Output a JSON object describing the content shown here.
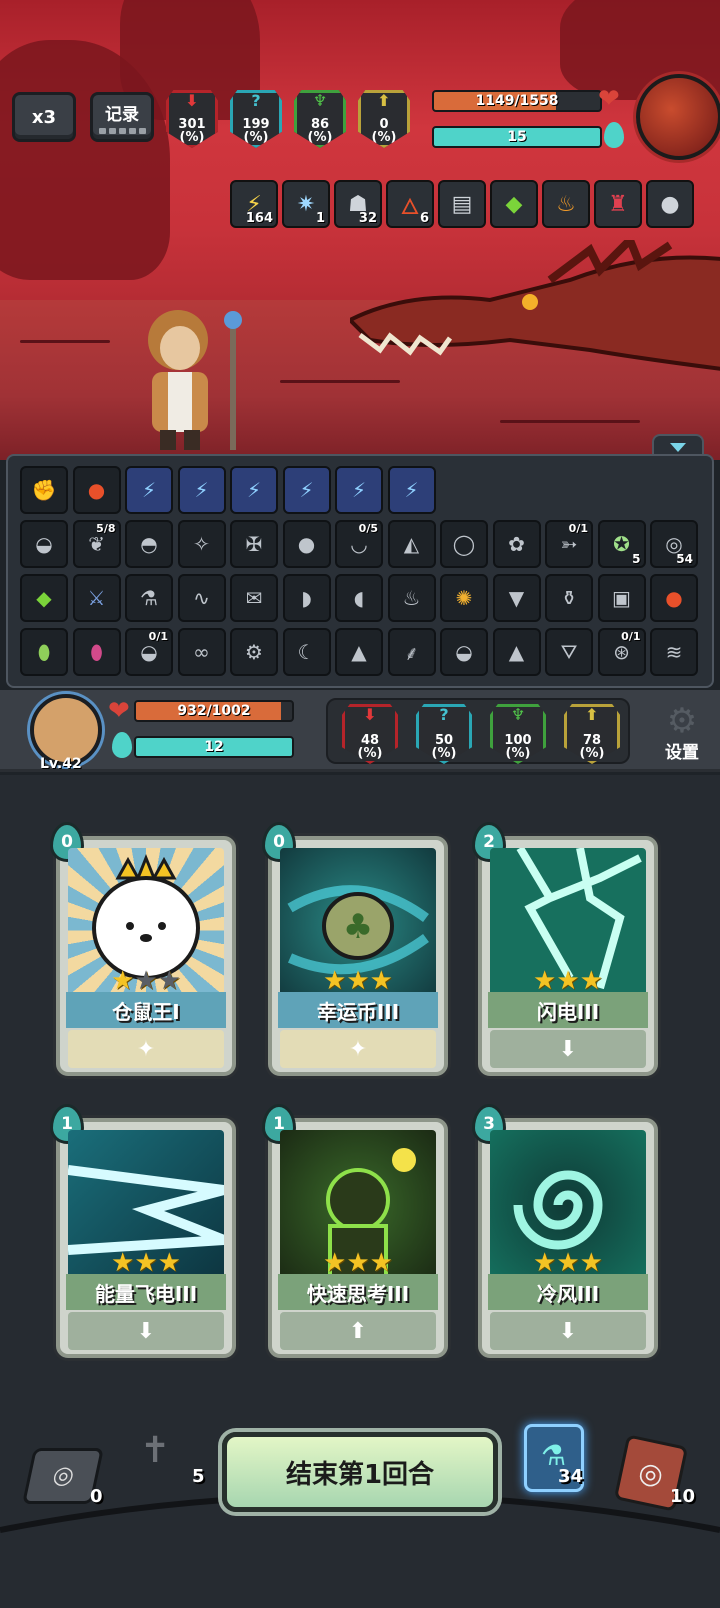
{
  "top_buttons": {
    "speed": "x3",
    "record": "记录"
  },
  "enemy": {
    "stats": [
      {
        "value": "301",
        "unit": "(%)"
      },
      {
        "value": "199",
        "unit": "(%)"
      },
      {
        "value": "86",
        "unit": "(%)"
      },
      {
        "value": "0",
        "unit": "(%)"
      }
    ],
    "hp_text": "1149/1558",
    "hp_fraction": 0.737,
    "mana_text": "15",
    "mana_fraction": 1.0,
    "buffs": [
      {
        "icon": "lightning-icon",
        "count": "164"
      },
      {
        "icon": "spark-icon",
        "count": "1"
      },
      {
        "icon": "hooded-figure-icon",
        "count": "32"
      },
      {
        "icon": "flame-icon",
        "count": "6"
      },
      {
        "icon": "book-icon",
        "count": ""
      },
      {
        "icon": "green-gem-icon",
        "count": ""
      },
      {
        "icon": "fire-cup-icon",
        "count": ""
      },
      {
        "icon": "red-potion-icon",
        "count": ""
      },
      {
        "icon": "bomb-icon",
        "count": ""
      }
    ]
  },
  "inventory": {
    "row1": [
      {
        "icon": "fist-icon",
        "count": ""
      },
      {
        "icon": "fire-apple-icon",
        "count": ""
      },
      {
        "icon": "lightning-card-icon",
        "count": ""
      },
      {
        "icon": "lightning-card-icon",
        "count": ""
      },
      {
        "icon": "lightning-card-icon",
        "count": ""
      },
      {
        "icon": "lightning-card-icon",
        "count": ""
      },
      {
        "icon": "lightning-card-icon",
        "count": ""
      },
      {
        "icon": "lightning-card-icon",
        "count": ""
      }
    ],
    "row2": [
      {
        "icon": "sack-icon",
        "count": "",
        "top": ""
      },
      {
        "icon": "leaf-blade-icon",
        "count": "",
        "top": "5/8"
      },
      {
        "icon": "bread-icon",
        "count": "",
        "top": ""
      },
      {
        "icon": "wand-icon",
        "count": "",
        "top": ""
      },
      {
        "icon": "crossbow-icon",
        "count": "",
        "top": ""
      },
      {
        "icon": "bomb-icon",
        "count": "",
        "top": ""
      },
      {
        "icon": "bowl-icon",
        "count": "",
        "top": "0/5"
      },
      {
        "icon": "helmet-icon",
        "count": "",
        "top": ""
      },
      {
        "icon": "ring-icon",
        "count": "",
        "top": ""
      },
      {
        "icon": "teddy-icon",
        "count": "",
        "top": ""
      },
      {
        "icon": "boomerang-icon",
        "count": "",
        "top": "0/1"
      },
      {
        "icon": "muscle-icon",
        "count": "5",
        "top": ""
      },
      {
        "icon": "spiral-icon",
        "count": "54",
        "top": ""
      }
    ],
    "row3": [
      {
        "icon": "green-gem-icon",
        "count": "",
        "top": ""
      },
      {
        "icon": "sword-icon",
        "count": "",
        "top": ""
      },
      {
        "icon": "potion-flask-icon",
        "count": "",
        "top": ""
      },
      {
        "icon": "rope-icon",
        "count": "",
        "top": ""
      },
      {
        "icon": "scroll-icon",
        "count": "",
        "top": ""
      },
      {
        "icon": "bread-roll-icon",
        "count": "",
        "top": ""
      },
      {
        "icon": "gravy-boat-icon",
        "count": "",
        "top": ""
      },
      {
        "icon": "meat-icon",
        "count": "",
        "top": ""
      },
      {
        "icon": "lion-icon",
        "count": "",
        "top": ""
      },
      {
        "icon": "ice-cream-icon",
        "count": "",
        "top": ""
      },
      {
        "icon": "vase-icon",
        "count": "",
        "top": ""
      },
      {
        "icon": "rune-card-icon",
        "count": "",
        "top": ""
      },
      {
        "icon": "fire-apple-icon",
        "count": "",
        "top": ""
      }
    ],
    "row4": [
      {
        "icon": "green-egg-icon",
        "count": "",
        "top": ""
      },
      {
        "icon": "rainbow-egg-icon",
        "count": "",
        "top": ""
      },
      {
        "icon": "coin-sack-icon",
        "count": "",
        "top": "0/1"
      },
      {
        "icon": "goggles-icon",
        "count": "",
        "top": ""
      },
      {
        "icon": "robot-icon",
        "count": "",
        "top": ""
      },
      {
        "icon": "moon-card-icon",
        "count": "",
        "top": ""
      },
      {
        "icon": "wolf-icon",
        "count": "",
        "top": ""
      },
      {
        "icon": "claw-icon",
        "count": "",
        "top": ""
      },
      {
        "icon": "pouch-icon",
        "count": "",
        "top": ""
      },
      {
        "icon": "onigiri-icon",
        "count": "",
        "top": ""
      },
      {
        "icon": "witch-hat-icon",
        "count": "",
        "top": ""
      },
      {
        "icon": "pacifier-icon",
        "count": "",
        "top": "0/1"
      },
      {
        "icon": "mummy-icon",
        "count": "",
        "top": ""
      }
    ]
  },
  "player": {
    "level": "Lv.42",
    "hp_text": "932/1002",
    "hp_fraction": 0.93,
    "mana_text": "12",
    "mana_fraction": 1.0,
    "stats": [
      {
        "value": "48",
        "unit": "(%)"
      },
      {
        "value": "50",
        "unit": "(%)"
      },
      {
        "value": "100",
        "unit": "(%)"
      },
      {
        "value": "78",
        "unit": "(%)"
      }
    ],
    "settings_label": "设置"
  },
  "cards": [
    {
      "name": "仓鼠王I",
      "cost": "0",
      "stars": 1,
      "max_stars": 3
    },
    {
      "name": "幸运币III",
      "cost": "0",
      "stars": 3,
      "max_stars": 3
    },
    {
      "name": "闪电III",
      "cost": "2",
      "stars": 3,
      "max_stars": 3
    },
    {
      "name": "能量飞电III",
      "cost": "1",
      "stars": 3,
      "max_stars": 3
    },
    {
      "name": "快速思考III",
      "cost": "1",
      "stars": 3,
      "max_stars": 3
    },
    {
      "name": "冷风III",
      "cost": "3",
      "stars": 3,
      "max_stars": 3
    }
  ],
  "footer": {
    "exhaust_count": "0",
    "grave_count": "5",
    "end_turn_label": "结束第1回合",
    "potion_count": "34",
    "deck_count": "10"
  },
  "colors": {
    "hp": "#d96b3a",
    "mana": "#4fd3c9",
    "star": "#f4c324"
  }
}
